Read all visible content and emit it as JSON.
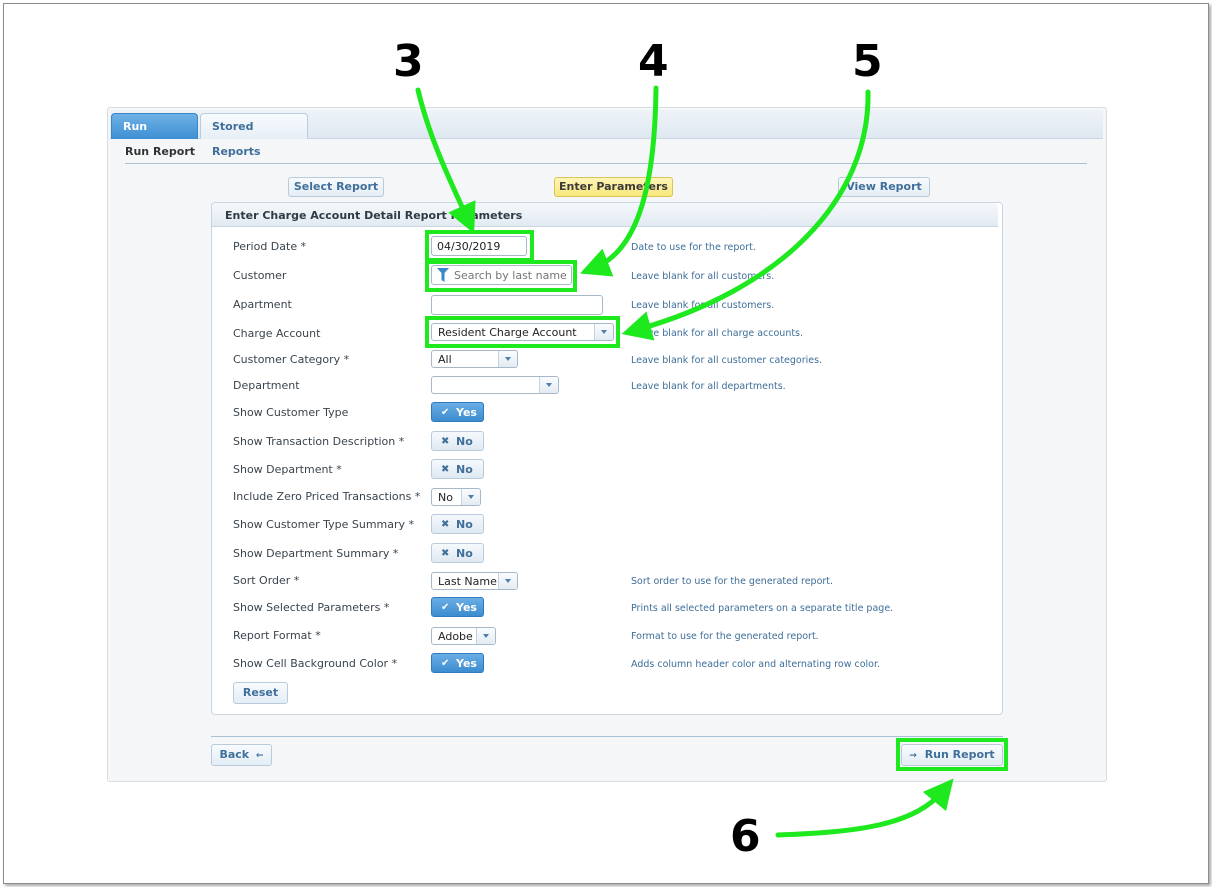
{
  "tabs": [
    {
      "label": "Run Report",
      "active": true
    },
    {
      "label": "Stored Reports",
      "active": false
    }
  ],
  "subtitle": "Run Report",
  "steps": [
    {
      "label": "Select Report",
      "state": "done"
    },
    {
      "label": "Enter Parameters",
      "state": "current"
    },
    {
      "label": "View Report",
      "state": "pending"
    }
  ],
  "form": {
    "title": "Enter Charge Account Detail Report Parameters",
    "rows": [
      {
        "label": "Period Date *",
        "control": "input",
        "value": "04/30/2019",
        "help": "Date to use for the report."
      },
      {
        "label": "Customer",
        "control": "search",
        "placeholder": "Search by last name",
        "icon": "funnel-icon",
        "help": "Leave blank for all customers."
      },
      {
        "label": "Apartment",
        "control": "input",
        "value": "",
        "help": "Leave blank for all customers."
      },
      {
        "label": "Charge Account",
        "control": "select",
        "value": "Resident Charge Account",
        "help": "Leave blank for all charge accounts."
      },
      {
        "label": "Customer Category *",
        "control": "select",
        "value": "All",
        "help": "Leave blank for all customer categories."
      },
      {
        "label": "Department",
        "control": "select",
        "value": "",
        "help": "Leave blank for all departments."
      },
      {
        "label": "Show Customer Type",
        "control": "toggle",
        "value": "Yes",
        "on": true,
        "help": ""
      },
      {
        "label": "Show Transaction Description *",
        "control": "toggle",
        "value": "No",
        "on": false,
        "help": ""
      },
      {
        "label": "Show Department *",
        "control": "toggle",
        "value": "No",
        "on": false,
        "help": ""
      },
      {
        "label": "Include Zero Priced Transactions *",
        "control": "select",
        "value": "No",
        "help": ""
      },
      {
        "label": "Show Customer Type Summary *",
        "control": "toggle",
        "value": "No",
        "on": false,
        "help": ""
      },
      {
        "label": "Show Department Summary *",
        "control": "toggle",
        "value": "No",
        "on": false,
        "help": ""
      },
      {
        "label": "Sort Order *",
        "control": "select",
        "value": "Last Name",
        "help": "Sort order to use for the generated report."
      },
      {
        "label": "Show Selected Parameters *",
        "control": "toggle",
        "value": "Yes",
        "on": true,
        "help": "Prints all selected parameters on a separate title page."
      },
      {
        "label": "Report Format *",
        "control": "select",
        "value": "Adobe",
        "help": "Format to use for the generated report."
      },
      {
        "label": "Show Cell Background Color *",
        "control": "toggle",
        "value": "Yes",
        "on": true,
        "help": "Adds column header color and alternating row color."
      }
    ],
    "reset_label": "Reset"
  },
  "footer": {
    "back_label": "Back",
    "back_glyph": "←",
    "run_label": "Run Report",
    "run_glyph": "→"
  },
  "glyphs": {
    "yes": "✔",
    "no": "✖"
  },
  "callouts": [
    "3",
    "4",
    "5",
    "6"
  ],
  "colors": {
    "highlight": "#1ee81e",
    "tab_active": "#3d8fd4",
    "step_current": "#f7e77a",
    "help_text": "#3e6e98"
  }
}
